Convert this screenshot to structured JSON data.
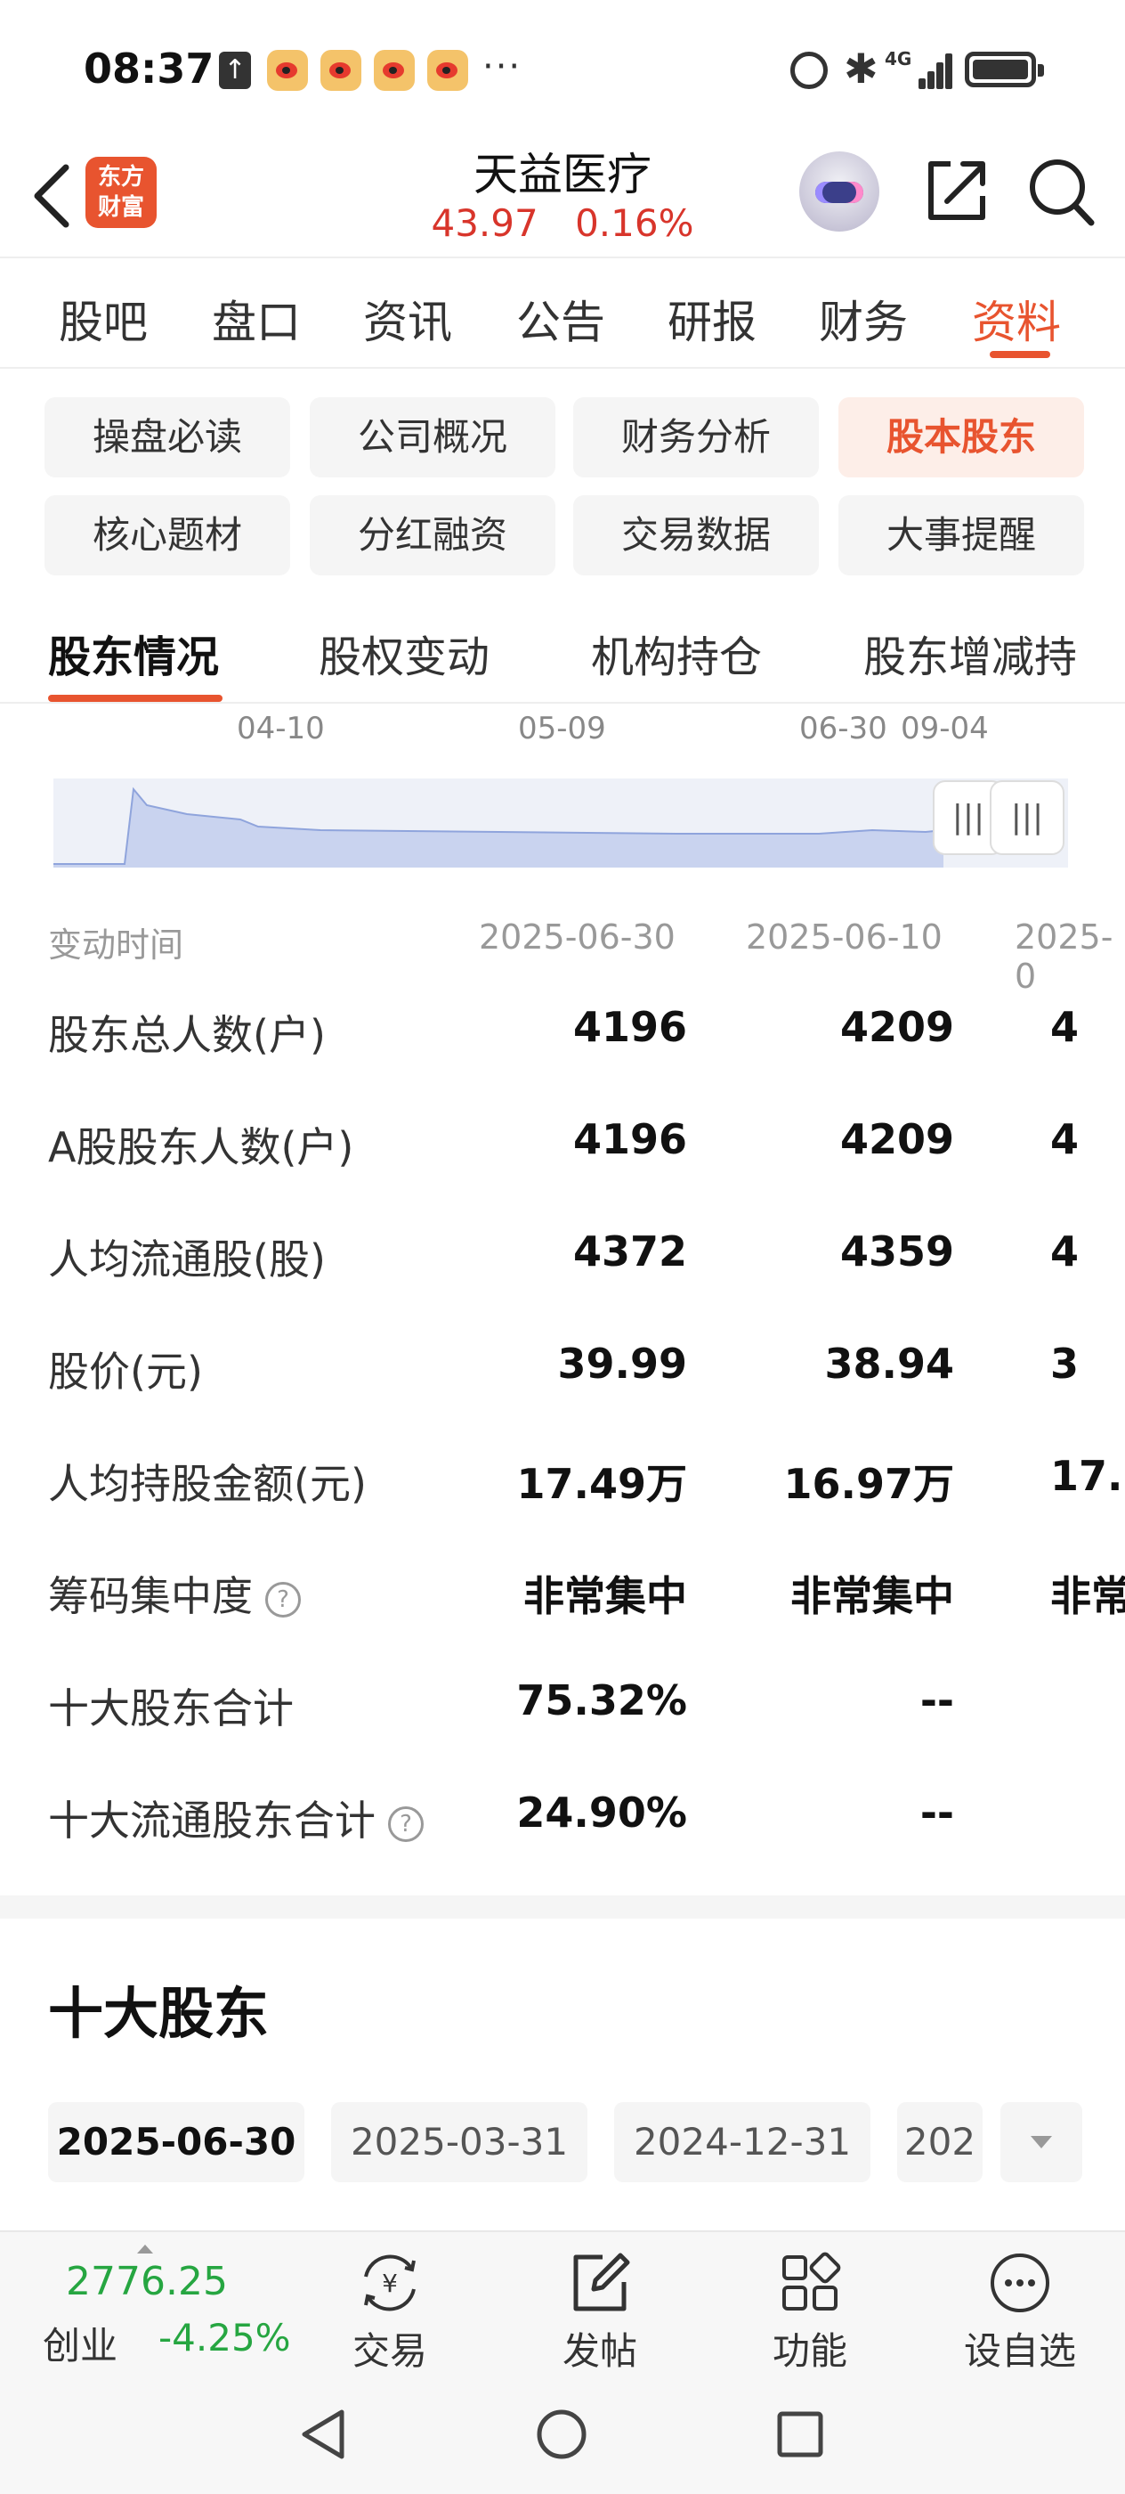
{
  "status_bar": {
    "time": "08:37",
    "upload_icon": "upload-arrow-icon",
    "notification_icons": [
      "weibo-icon",
      "weibo-icon",
      "weibo-icon",
      "weibo-icon"
    ],
    "more": "···",
    "network": "4G"
  },
  "header": {
    "app_logo": "东方\n财富",
    "stock_name": "天益医疗",
    "price": "43.97",
    "change_pct": "0.16%",
    "price_color": "#d8352b"
  },
  "main_tabs": [
    "股吧",
    "盘口",
    "资讯",
    "公告",
    "研报",
    "财务",
    "资料"
  ],
  "main_tab_active": "资料",
  "chips": [
    "操盘必读",
    "公司概况",
    "财务分析",
    "股本股东",
    "核心题材",
    "分红融资",
    "交易数据",
    "大事提醒"
  ],
  "chip_active": "股本股东",
  "section_tabs": [
    "股东情况",
    "股权变动",
    "机构持仓",
    "股东增减持"
  ],
  "section_tab_active": "股东情况",
  "mini_chart": {
    "ticks": [
      "04-10",
      "05-09",
      "06-30",
      "09-04"
    ]
  },
  "table": {
    "header_label": "变动时间",
    "columns": [
      "2025-06-30",
      "2025-06-10",
      "2025-0"
    ],
    "rows": [
      {
        "label": "股东总人数(户)",
        "values": [
          "4196",
          "4209",
          "4"
        ]
      },
      {
        "label": "A股股东人数(户)",
        "values": [
          "4196",
          "4209",
          "4"
        ]
      },
      {
        "label": "人均流通股(股)",
        "values": [
          "4372",
          "4359",
          "4"
        ]
      },
      {
        "label": "股价(元)",
        "values": [
          "39.99",
          "38.94",
          "3"
        ]
      },
      {
        "label": "人均持股金额(元)",
        "values": [
          "17.49万",
          "16.97万",
          "17."
        ]
      },
      {
        "label": "筹码集中度",
        "values": [
          "非常集中",
          "非常集中",
          "非常"
        ]
      },
      {
        "label": "十大股东合计",
        "values": [
          "75.32%",
          "--",
          ""
        ]
      },
      {
        "label": "十大流通股东合计",
        "values": [
          "24.90%",
          "--",
          ""
        ]
      }
    ],
    "help_glyph": "?"
  },
  "top10": {
    "title": "十大股东",
    "dates": [
      "2025-06-30",
      "2025-03-31",
      "2024-12-31",
      "202"
    ]
  },
  "bottom_bar": {
    "index_value": "2776.25",
    "index_name": "创业",
    "index_change": "-4.25%",
    "items": [
      "交易",
      "发帖",
      "功能",
      "设自选"
    ],
    "trade_glyph": "¥"
  },
  "colors": {
    "accent": "#e8542f",
    "up": "#d8352b",
    "down": "#26a641"
  }
}
